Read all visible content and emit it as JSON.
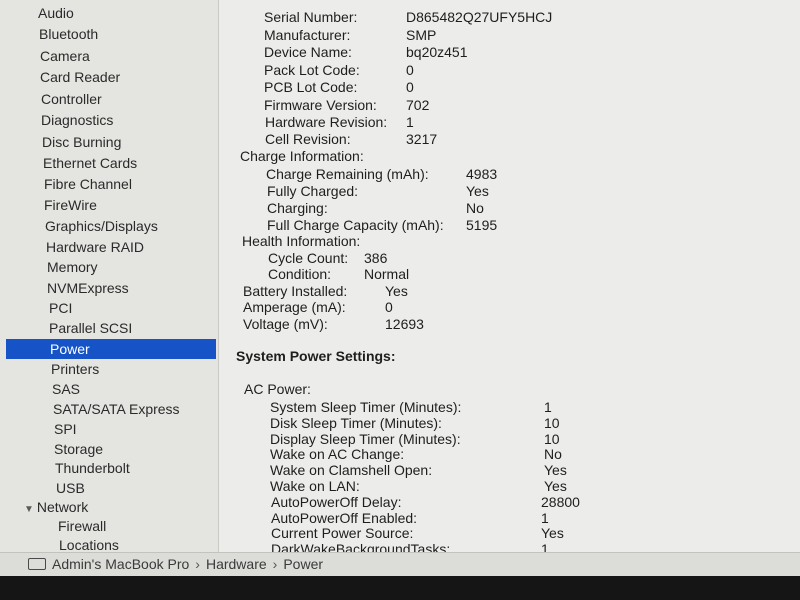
{
  "sidebar": {
    "items": [
      {
        "label": "Audio"
      },
      {
        "label": "Bluetooth"
      },
      {
        "label": "Camera"
      },
      {
        "label": "Card Reader"
      },
      {
        "label": "Controller"
      },
      {
        "label": "Diagnostics"
      },
      {
        "label": "Disc Burning"
      },
      {
        "label": "Ethernet Cards"
      },
      {
        "label": "Fibre Channel"
      },
      {
        "label": "FireWire"
      },
      {
        "label": "Graphics/Displays"
      },
      {
        "label": "Hardware RAID"
      },
      {
        "label": "Memory"
      },
      {
        "label": "NVMExpress"
      },
      {
        "label": "PCI"
      },
      {
        "label": "Parallel SCSI"
      },
      {
        "label": "Power",
        "selected": true
      },
      {
        "label": "Printers"
      },
      {
        "label": "SAS"
      },
      {
        "label": "SATA/SATA Express"
      },
      {
        "label": "SPI"
      },
      {
        "label": "Storage"
      },
      {
        "label": "Thunderbolt"
      },
      {
        "label": "USB"
      },
      {
        "label": "Network",
        "expanded": true
      },
      {
        "label": "Firewall"
      },
      {
        "label": "Locations"
      }
    ],
    "selected_color": "#1553c7",
    "disclosure_icon": "triangle-down"
  },
  "model_info": {
    "rows": [
      {
        "key": "Serial Number:",
        "value": "D865482Q27UFY5HCJ"
      },
      {
        "key": "Manufacturer:",
        "value": "SMP"
      },
      {
        "key": "Device Name:",
        "value": "bq20z451"
      },
      {
        "key": "Pack Lot Code:",
        "value": "0"
      },
      {
        "key": "PCB Lot Code:",
        "value": "0"
      },
      {
        "key": "Firmware Version:",
        "value": "702"
      },
      {
        "key": "Hardware Revision:",
        "value": "1"
      },
      {
        "key": "Cell Revision:",
        "value": "3217"
      }
    ]
  },
  "charge_info": {
    "heading": "Charge Information:",
    "rows": [
      {
        "key": "Charge Remaining (mAh):",
        "value": "4983"
      },
      {
        "key": "Fully Charged:",
        "value": "Yes"
      },
      {
        "key": "Charging:",
        "value": "No"
      },
      {
        "key": "Full Charge Capacity (mAh):",
        "value": "5195"
      }
    ]
  },
  "health_info": {
    "heading": "Health Information:",
    "rows": [
      {
        "key": "Cycle Count:",
        "value": "386"
      },
      {
        "key": "Condition:",
        "value": "Normal"
      }
    ]
  },
  "battery_rows": [
    {
      "key": "Battery Installed:",
      "value": "Yes"
    },
    {
      "key": "Amperage (mA):",
      "value": "0"
    },
    {
      "key": "Voltage (mV):",
      "value": "12693"
    }
  ],
  "system_power": {
    "heading": "System Power Settings:",
    "ac_heading": "AC Power:",
    "rows": [
      {
        "key": "System Sleep Timer (Minutes):",
        "value": "1"
      },
      {
        "key": "Disk Sleep Timer (Minutes):",
        "value": "10"
      },
      {
        "key": "Display Sleep Timer (Minutes):",
        "value": "10"
      },
      {
        "key": "Wake on AC Change:",
        "value": "No"
      },
      {
        "key": "Wake on Clamshell Open:",
        "value": "Yes"
      },
      {
        "key": "Wake on LAN:",
        "value": "Yes"
      },
      {
        "key": "AutoPowerOff Delay:",
        "value": "28800"
      },
      {
        "key": "AutoPowerOff Enabled:",
        "value": "1"
      },
      {
        "key": "Current Power Source:",
        "value": "Yes"
      },
      {
        "key": "DarkWakeBackgroundTasks:",
        "value": "1"
      }
    ]
  },
  "pathbar": {
    "icon": "laptop-icon",
    "segments": [
      "Admin's MacBook Pro",
      "Hardware",
      "Power"
    ],
    "separator": "›"
  }
}
